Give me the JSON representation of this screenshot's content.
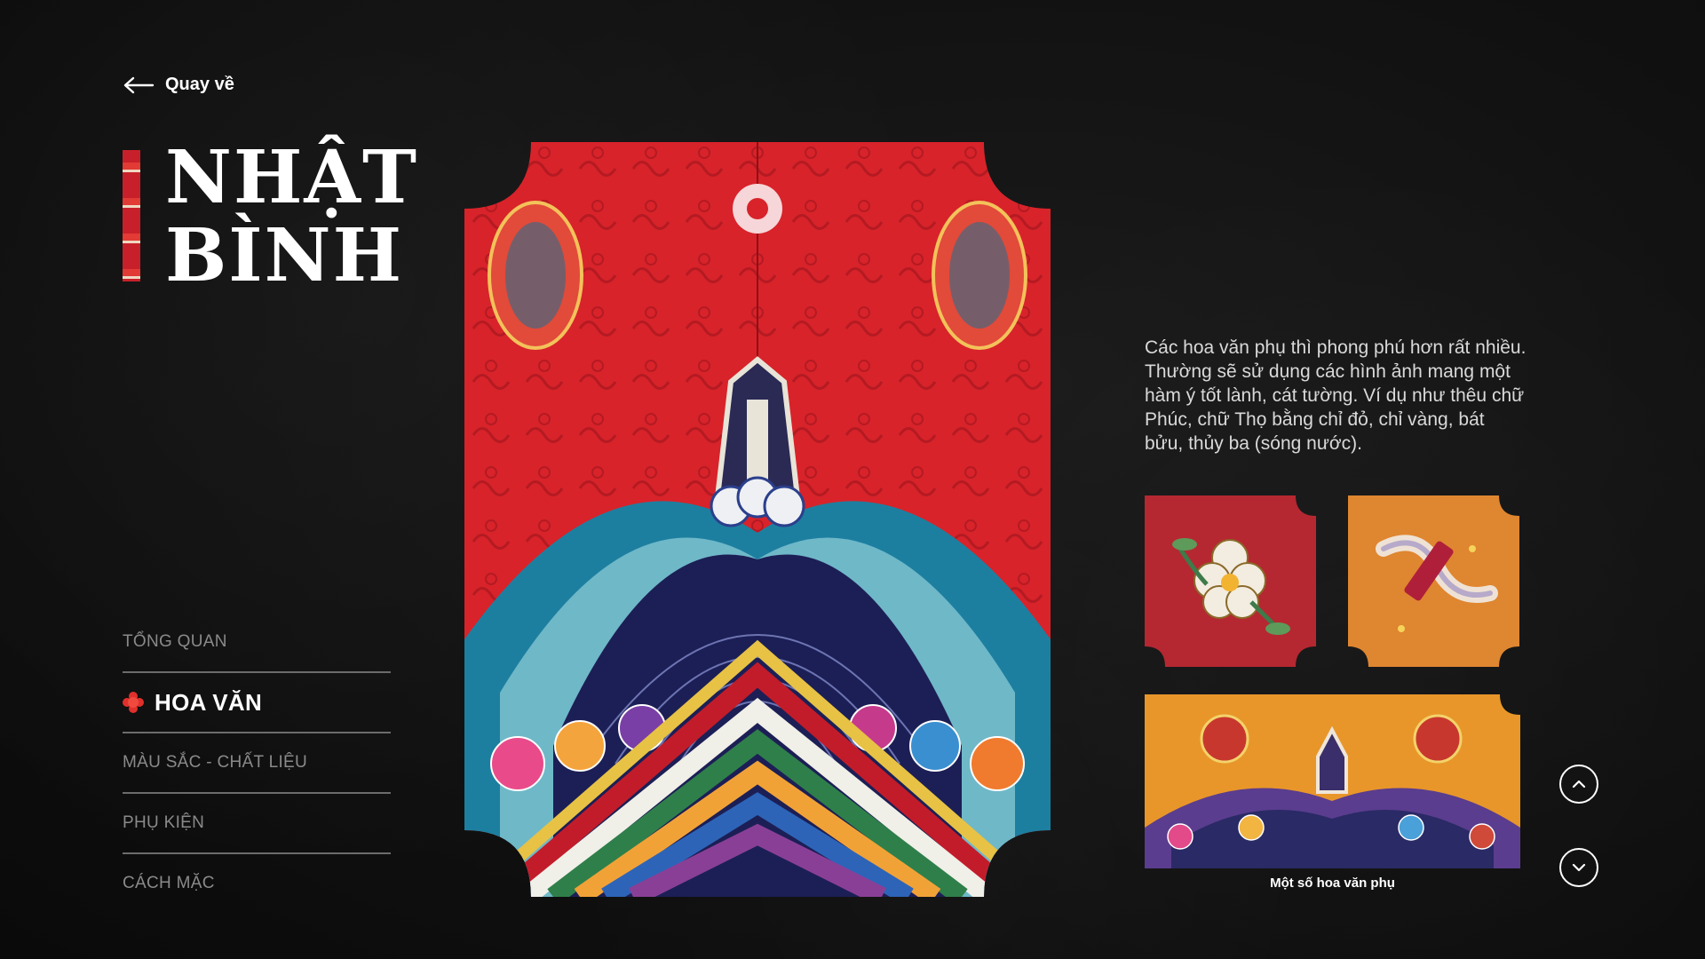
{
  "back": {
    "label": "Quay về",
    "icon": "arrow-left-icon"
  },
  "title": {
    "line1": "NHẬT",
    "line2": "BÌNH"
  },
  "nav": {
    "items": [
      {
        "label": "TỔNG QUAN",
        "active": false
      },
      {
        "label": "HOA VĂN",
        "active": true,
        "icon": "flower-icon"
      },
      {
        "label": "MÀU SẮC - CHẤT LIỆU",
        "active": false
      },
      {
        "label": "PHỤ KIỆN",
        "active": false
      },
      {
        "label": "CÁCH MẶC",
        "active": false
      }
    ]
  },
  "description": "Các hoa văn phụ thì phong phú hơn rất nhiều. Thường sẽ sử dụng các hình ảnh mang một hàm ý tốt lành, cát tường. Ví dụ như thêu chữ Phúc, chữ Thọ bằng chỉ đỏ, chỉ vàng, bát bửu, thủy ba (sóng nước).",
  "gallery": {
    "caption": "Một số hoa văn phụ"
  },
  "controls": {
    "up_icon": "chevron-up-icon",
    "down_icon": "chevron-down-icon"
  },
  "colors": {
    "background": "#111111",
    "accent": "#e0302c",
    "muted": "#8a8a8a",
    "divider": "#6c6c6c"
  }
}
